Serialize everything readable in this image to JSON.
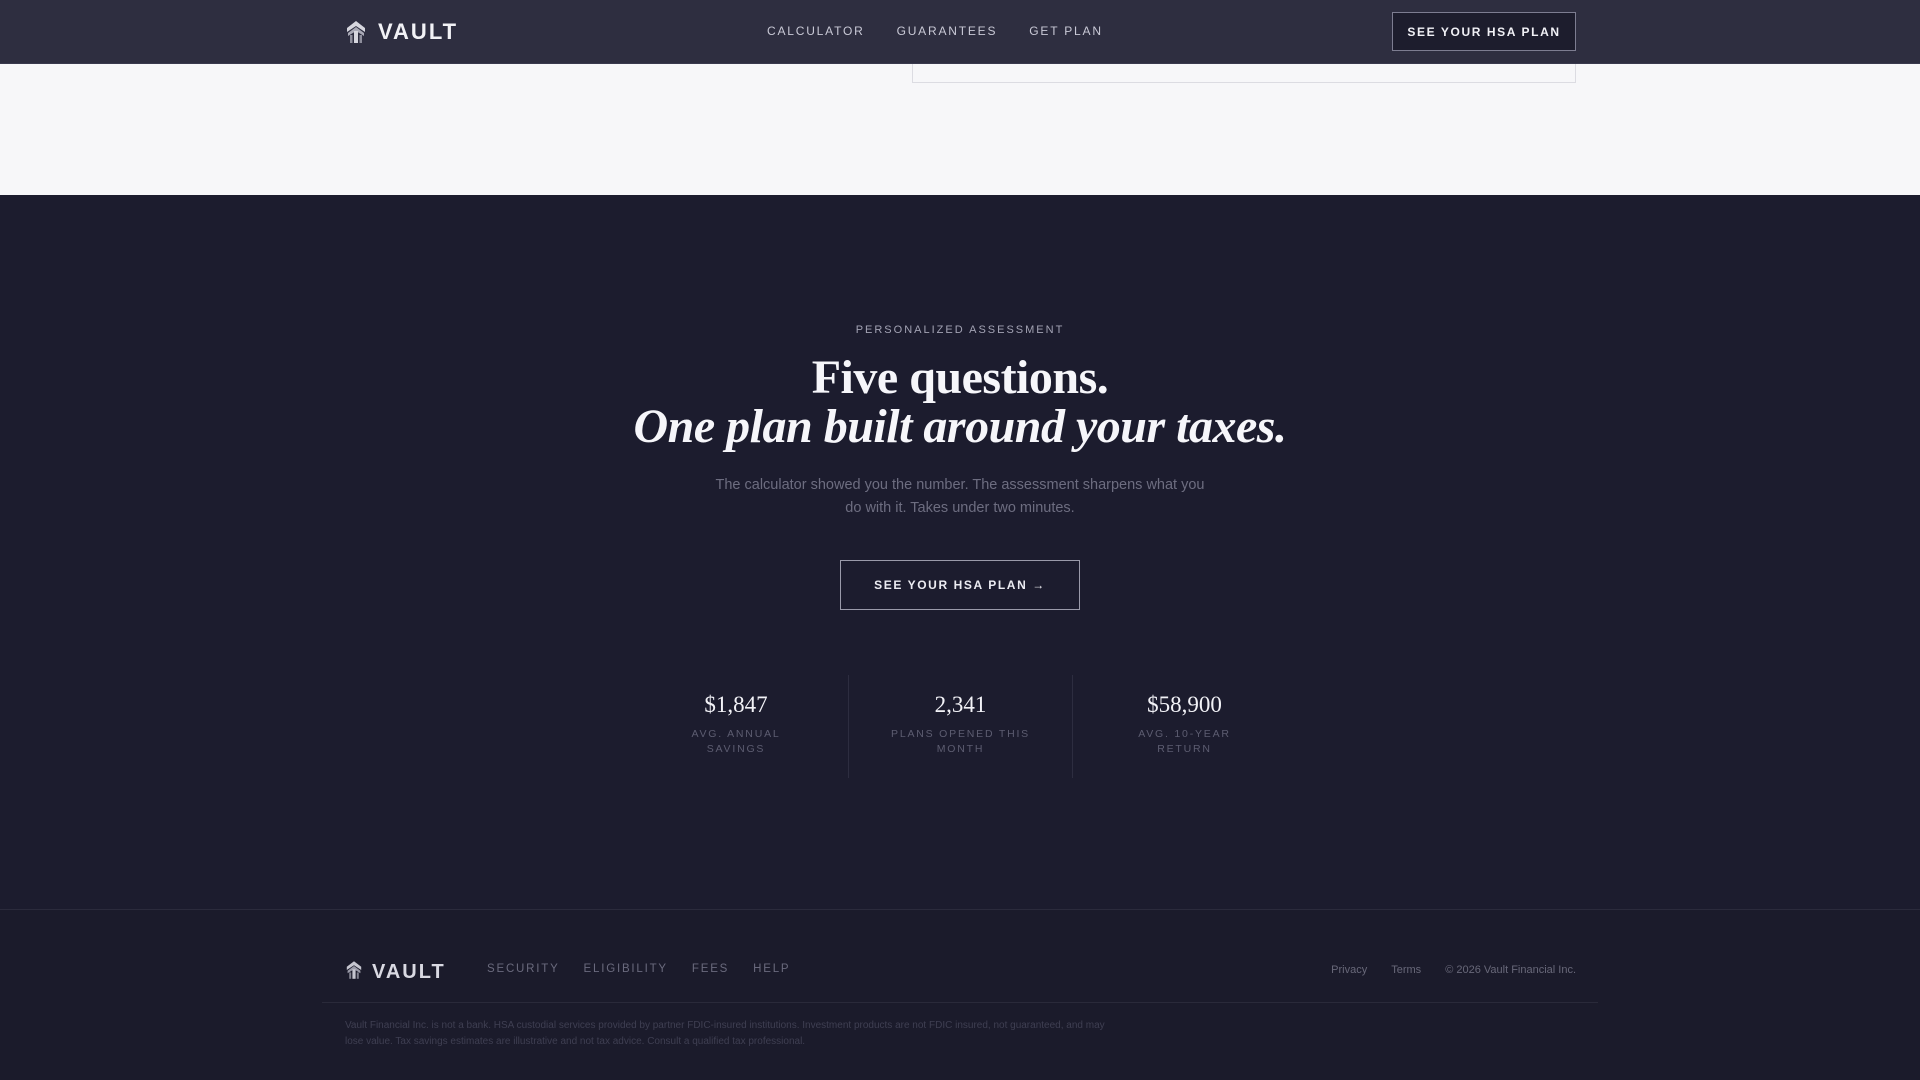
{
  "nav": {
    "brand": "VAULT",
    "links": [
      {
        "label": "CALCULATOR"
      },
      {
        "label": "GUARANTEES"
      },
      {
        "label": "GET PLAN"
      }
    ],
    "cta": "SEE YOUR HSA PLAN"
  },
  "hero": {
    "eyebrow": "PERSONALIZED ASSESSMENT",
    "headline_line1": "Five questions.",
    "headline_line2": "One plan built around your taxes.",
    "subtext": "The calculator showed you the number. The assessment sharpens what you do with it. Takes under two minutes.",
    "cta": "SEE YOUR HSA PLAN →",
    "stats": [
      {
        "value": "$1,847",
        "label": "AVG. ANNUAL SAVINGS"
      },
      {
        "value": "2,341",
        "label": "PLANS OPENED THIS MONTH"
      },
      {
        "value": "$58,900",
        "label": "AVG. 10-YEAR RETURN"
      }
    ]
  },
  "footer": {
    "brand": "VAULT",
    "links": [
      {
        "label": "SECURITY"
      },
      {
        "label": "ELIGIBILITY"
      },
      {
        "label": "FEES"
      },
      {
        "label": "HELP"
      }
    ],
    "privacy": "Privacy",
    "terms": "Terms",
    "copyright": "© 2026 Vault Financial Inc.",
    "disclaimer": "Vault Financial Inc. is not a bank. HSA custodial services provided by partner FDIC-insured institutions. Investment products are not FDIC insured, not guaranteed, and may lose value. Tax savings estimates are illustrative and not tax advice. Consult a qualified tax professional."
  },
  "icons": {
    "logo": "shield-arrow-logo-icon"
  },
  "colors": {
    "background": "#1c1c2e",
    "nav": "#2e2e40",
    "light_band": "#f7f7f9",
    "text_primary": "#f6f6fa",
    "text_muted": "#6d6d80"
  }
}
